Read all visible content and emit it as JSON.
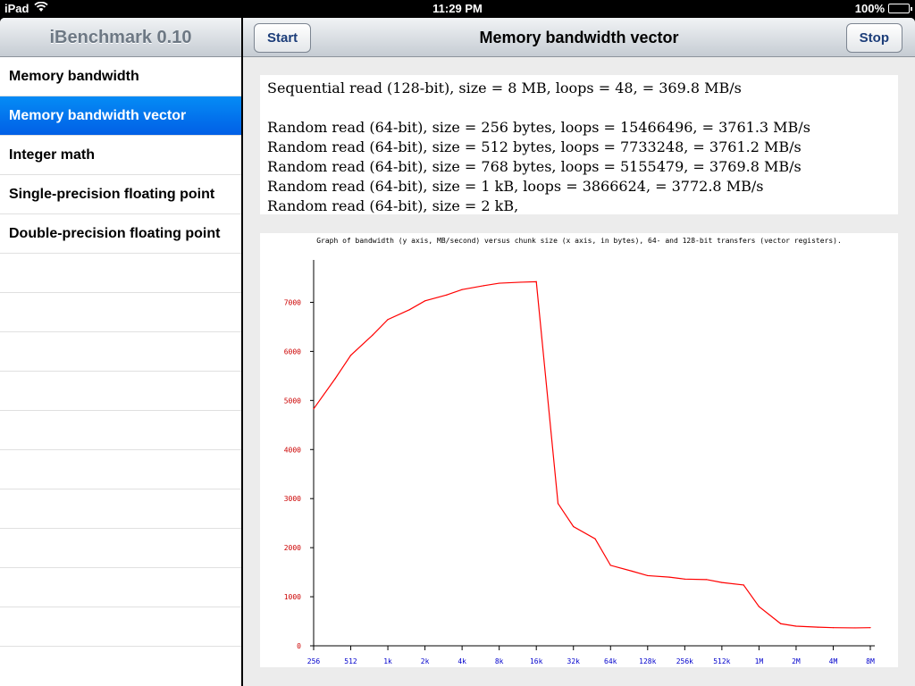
{
  "status_bar": {
    "device": "iPad",
    "time": "11:29 PM",
    "battery": "100%",
    "battery_level": 1.0
  },
  "master": {
    "title": "iBenchmark 0.10",
    "items": [
      {
        "label": "Memory bandwidth",
        "selected": false
      },
      {
        "label": "Memory bandwidth vector",
        "selected": true
      },
      {
        "label": "Integer math",
        "selected": false
      },
      {
        "label": "Single-precision floating point",
        "selected": false
      },
      {
        "label": "Double-precision floating point",
        "selected": false
      }
    ]
  },
  "detail": {
    "title": "Memory bandwidth vector",
    "start_label": "Start",
    "stop_label": "Stop",
    "log_lines": [
      "Sequential read (128-bit), size = 8 MB, loops = 48,  = 369.8 MB/s",
      "",
      "Random read (64-bit), size = 256 bytes, loops = 15466496,  = 3761.3 MB/s",
      "Random read (64-bit), size = 512 bytes, loops = 7733248,  = 3761.2 MB/s",
      "Random read (64-bit), size = 768 bytes, loops = 5155479,  = 3769.8 MB/s",
      "Random read (64-bit), size = 1 kB, loops = 3866624,  = 3772.8 MB/s",
      "Random read (64-bit), size = 2 kB,"
    ]
  },
  "colors": {
    "selected_row": "#0273ee",
    "line": "#ff0000",
    "y_ticks": "#cc0000",
    "x_ticks": "#0000cc"
  },
  "chart_data": {
    "type": "line",
    "title": "Graph of bandwidth (y axis, MB/second) versus chunk size (x axis, in bytes), 64- and 128-bit transfers (vector registers).",
    "xlabel": "",
    "ylabel": "",
    "x_tick_labels": [
      "256",
      "512",
      "1k",
      "2k",
      "4k",
      "8k",
      "16k",
      "32k",
      "64k",
      "128k",
      "256k",
      "512k",
      "1M",
      "2M",
      "4M",
      "8M"
    ],
    "y_ticks": [
      0,
      1000,
      2000,
      3000,
      4000,
      5000,
      6000,
      7000
    ],
    "ylim": [
      0,
      7500
    ],
    "x": [
      "256",
      "384",
      "512",
      "768",
      "1k",
      "1.5k",
      "2k",
      "3k",
      "4k",
      "6k",
      "8k",
      "12k",
      "16k",
      "24k",
      "32k",
      "48k",
      "64k",
      "96k",
      "128k",
      "192k",
      "256k",
      "384k",
      "512k",
      "768k",
      "1M",
      "1.5M",
      "2M",
      "3M",
      "4M",
      "6M",
      "8M"
    ],
    "x_pos": [
      0,
      0.585,
      1,
      1.585,
      2,
      2.585,
      3,
      3.585,
      4,
      4.585,
      5,
      5.585,
      6,
      6.585,
      7,
      7.585,
      8,
      8.585,
      9,
      9.585,
      10,
      10.585,
      11,
      11.585,
      12,
      12.585,
      13,
      13.585,
      14,
      14.585,
      15
    ],
    "series": [
      {
        "values": [
          4830,
          5450,
          5920,
          6330,
          6650,
          6850,
          7030,
          7150,
          7260,
          7340,
          7390,
          7410,
          7420,
          2900,
          2430,
          2180,
          1640,
          1520,
          1430,
          1400,
          1360,
          1350,
          1290,
          1240,
          800,
          450,
          400,
          380,
          370,
          365,
          370
        ]
      }
    ]
  }
}
